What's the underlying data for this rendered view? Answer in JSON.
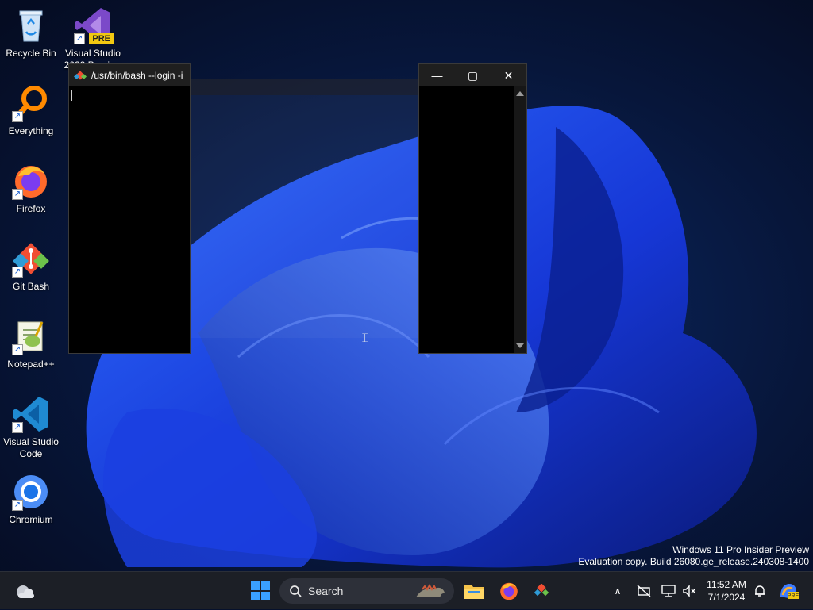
{
  "desktop": {
    "icons": [
      {
        "label": "Recycle Bin"
      },
      {
        "label": "Everything"
      },
      {
        "label": "Firefox"
      },
      {
        "label": "Git Bash"
      },
      {
        "label": "Notepad++"
      },
      {
        "label": "Visual Studio Code"
      },
      {
        "label": "Chromium"
      },
      {
        "label": "Visual Studio 2022 Preview",
        "badge": "PRE"
      }
    ]
  },
  "windows": {
    "bash_title": "/usr/bin/bash --login -i"
  },
  "watermark": {
    "line1": "Windows 11 Pro Insider Preview",
    "line2": "Evaluation copy. Build 26080.ge_release.240308-1400"
  },
  "taskbar": {
    "search_label": "Search",
    "time": "11:52 AM",
    "date": "7/1/2024"
  },
  "colors": {
    "accent": "#1f5cff",
    "taskbar_bg": "#1c1f26",
    "terminal_bg": "#000000"
  }
}
